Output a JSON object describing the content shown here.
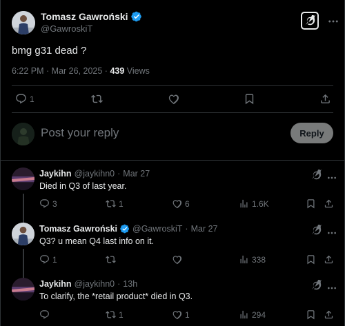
{
  "main_tweet": {
    "author_name": "Tomasz Gawroński",
    "author_handle": "@GawroskiT",
    "text": "bmg g31 dead ?",
    "timestamp": "6:22 PM · Mar 26, 2025 · ",
    "views_count": "439",
    "views_label": " Views",
    "reply_count": "1",
    "retweet_count": "",
    "like_count": ""
  },
  "composer": {
    "placeholder": "Post your reply",
    "reply_button_label": "Reply"
  },
  "replies": [
    {
      "name": "Jaykihn",
      "handle": "@jaykihn0",
      "separator": "·",
      "time": "Mar 27",
      "text": "Died in Q3 of last year.",
      "replies": "3",
      "retweets": "1",
      "likes": "6",
      "views": "1.6K",
      "verified": false
    },
    {
      "name": "Tomasz Gawroński",
      "handle": "@GawroskiT",
      "separator": "·",
      "time": "Mar 27",
      "text": "Q3? u mean Q4 last info on it.",
      "replies": "1",
      "retweets": "",
      "likes": "",
      "views": "338",
      "verified": true
    },
    {
      "name": "Jaykihn",
      "handle": "@jaykihn0",
      "separator": "·",
      "time": "13h",
      "text": "To clarify, the *retail product* died in Q3.",
      "replies": "",
      "retweets": "1",
      "likes": "1",
      "views": "294",
      "verified": false
    }
  ],
  "colors": {
    "background": "#000000",
    "text": "#e7e9ea",
    "muted": "#71767b",
    "border": "#2f3336",
    "verified": "#1d9bf0",
    "reply_button": "#787a7a"
  },
  "icons": [
    "verified-badge-icon",
    "grok-icon",
    "more-icon",
    "reply-icon",
    "retweet-icon",
    "like-icon",
    "bookmark-icon",
    "share-icon",
    "views-icon"
  ]
}
